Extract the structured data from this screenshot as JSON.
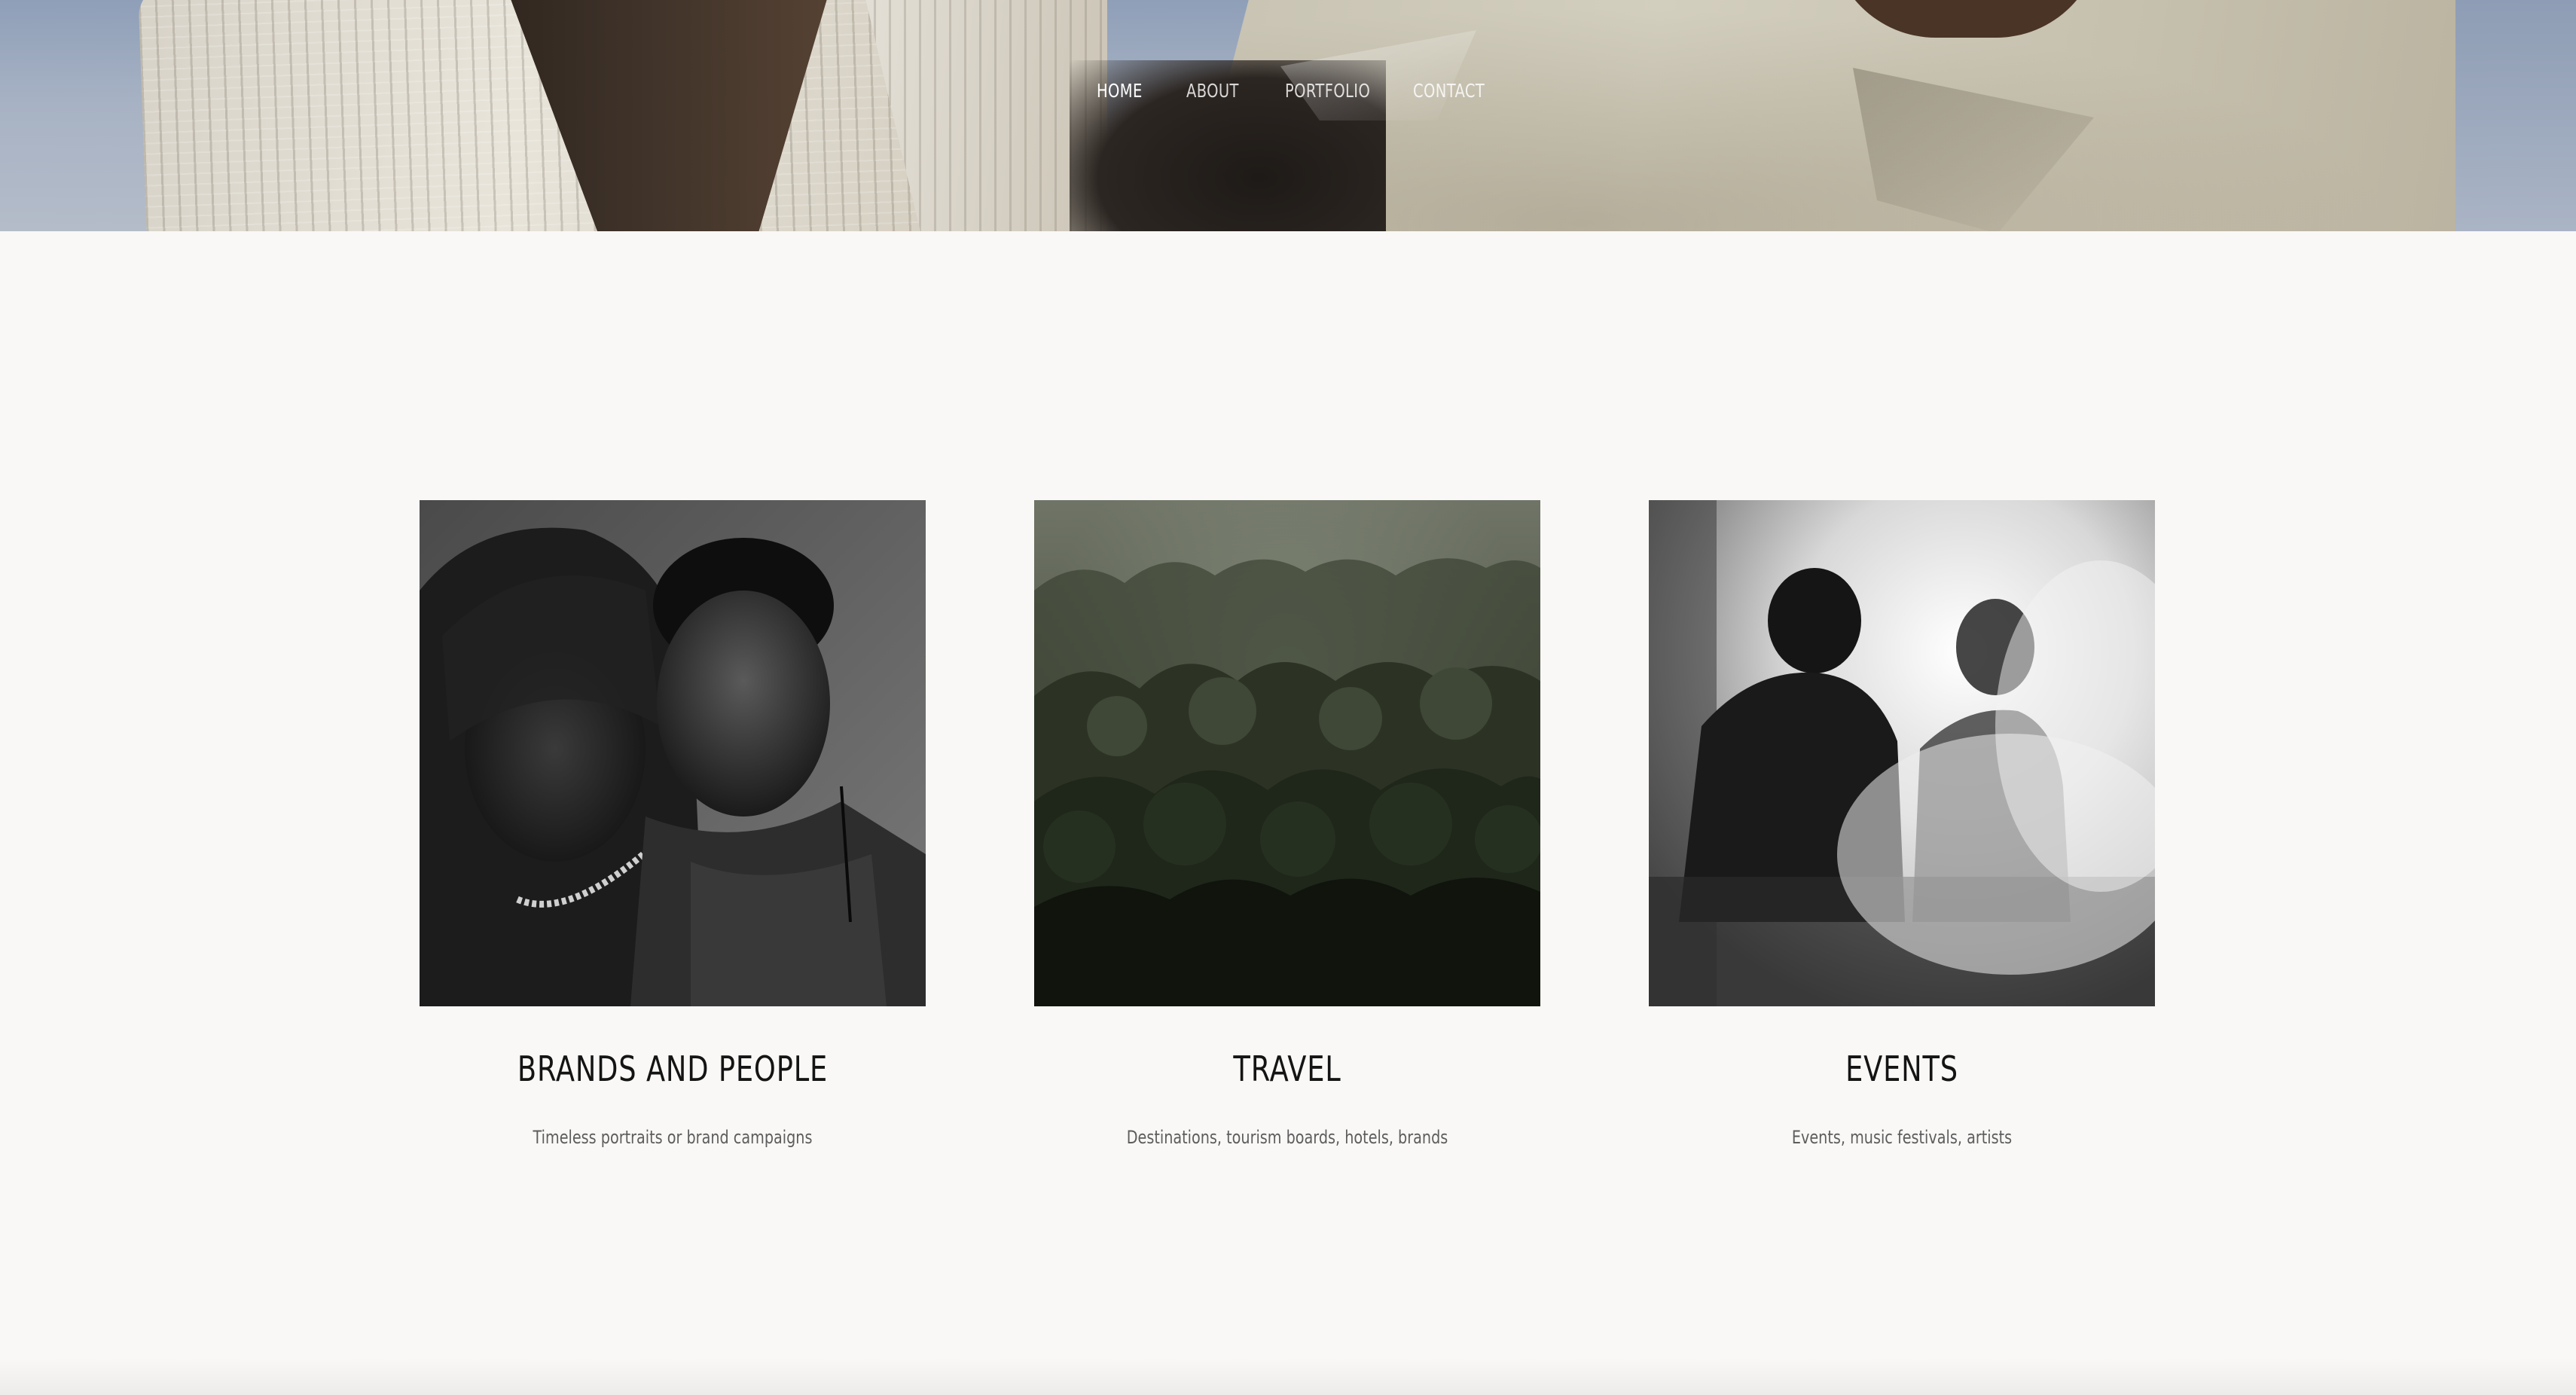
{
  "nav": {
    "items": [
      {
        "label": "HOME",
        "active": true
      },
      {
        "label": "ABOUT",
        "active": false
      },
      {
        "label": "PORTFOLIO",
        "active": false
      },
      {
        "label": "CONTACT",
        "active": false
      }
    ]
  },
  "cards": [
    {
      "title": "BRANDS AND PEOPLE",
      "subtitle": "Timeless portraits or brand campaigns"
    },
    {
      "title": "TRAVEL",
      "subtitle": "Destinations, tourism boards, hotels, brands"
    },
    {
      "title": "EVENTS",
      "subtitle": "Events, music festivals, artists"
    }
  ],
  "colors": {
    "background": "#f9f8f6",
    "title": "#141414",
    "subtitle": "#5d5d5d",
    "nav_active": "#ffffff"
  }
}
